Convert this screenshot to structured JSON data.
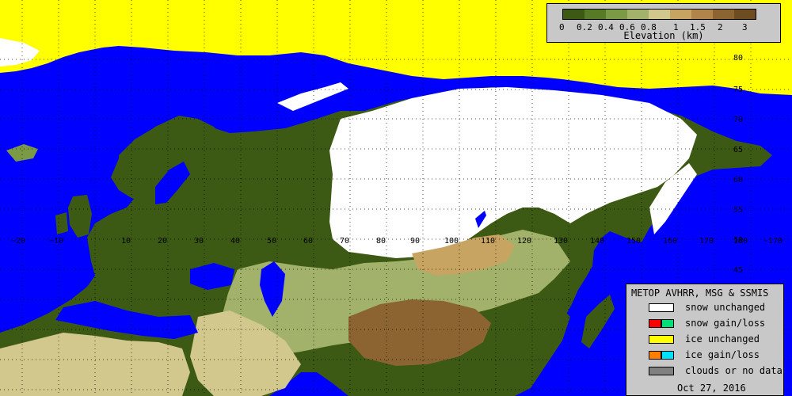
{
  "elevation_legend": {
    "title": "Elevation (km)",
    "ticks": [
      "0",
      "0.2",
      "0.4",
      "0.6",
      "0.8",
      "1",
      "1.5",
      "2",
      "3"
    ],
    "colors": [
      "#3c5a14",
      "#567a26",
      "#7a9a46",
      "#a2b26a",
      "#d2c88e",
      "#c8a462",
      "#b0844a",
      "#8c6432",
      "#6c4c20"
    ]
  },
  "product_legend": {
    "header": "METOP AVHRR, MSG & SSMIS",
    "items": [
      {
        "label": "snow unchanged",
        "colors": [
          "#ffffff"
        ]
      },
      {
        "label": "snow gain/loss",
        "colors": [
          "#ff0000",
          "#00e07a"
        ]
      },
      {
        "label": "ice unchanged",
        "colors": [
          "#ffff00"
        ]
      },
      {
        "label": "ice gain/loss",
        "colors": [
          "#ff8000",
          "#00e0ff"
        ]
      },
      {
        "label": "clouds or no data",
        "colors": [
          "#808080"
        ]
      }
    ],
    "date": "Oct 27, 2016"
  },
  "longitude_labels": [
    "−20",
    "−10",
    "10",
    "20",
    "30",
    "40",
    "50",
    "60",
    "70",
    "80",
    "90",
    "100",
    "110",
    "120",
    "130",
    "140",
    "150",
    "160",
    "170",
    "180",
    "−170"
  ],
  "latitude_labels": [
    "80",
    "75",
    "70",
    "65",
    "60",
    "55",
    "50",
    "45"
  ],
  "colors": {
    "ocean": "#0000ff",
    "sea_ice": "#ffff00",
    "snow": "#ffffff",
    "lowland": "#3c5a14",
    "upland": "#a2b26a",
    "mountain": "#8c6432"
  }
}
